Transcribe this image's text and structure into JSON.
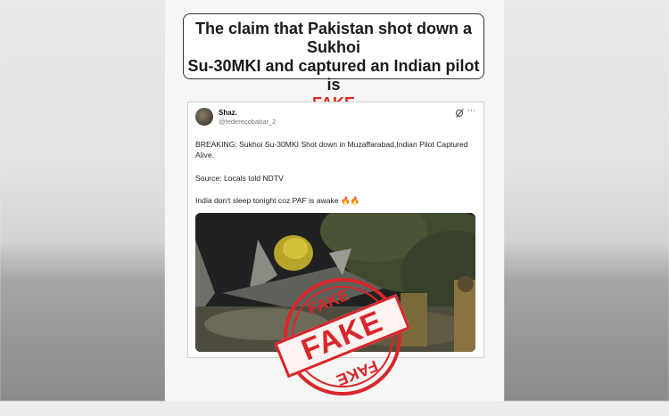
{
  "headline": {
    "line1": "The claim that Pakistan shot down a Sukhoi",
    "line2": "Su-30MKI and captured an Indian pilot is",
    "verdict": "FAKE"
  },
  "tweet": {
    "name": "Shaz.",
    "handle": "@federecobabar_2",
    "more_icon": "⋯",
    "text1": "BREAKING: Sukhoi Su-30MKI Shot down in Muzaffarabad,Indian Pilot Captured Alive.",
    "text2": "Source: Locals told NDTV",
    "text3": "India don't sleep tonight coz PAF is awake 🔥🔥"
  },
  "stamp": {
    "word": "FAKE"
  },
  "colors": {
    "verdict_red": "#e0261e",
    "stamp_red": "#d9262a"
  }
}
